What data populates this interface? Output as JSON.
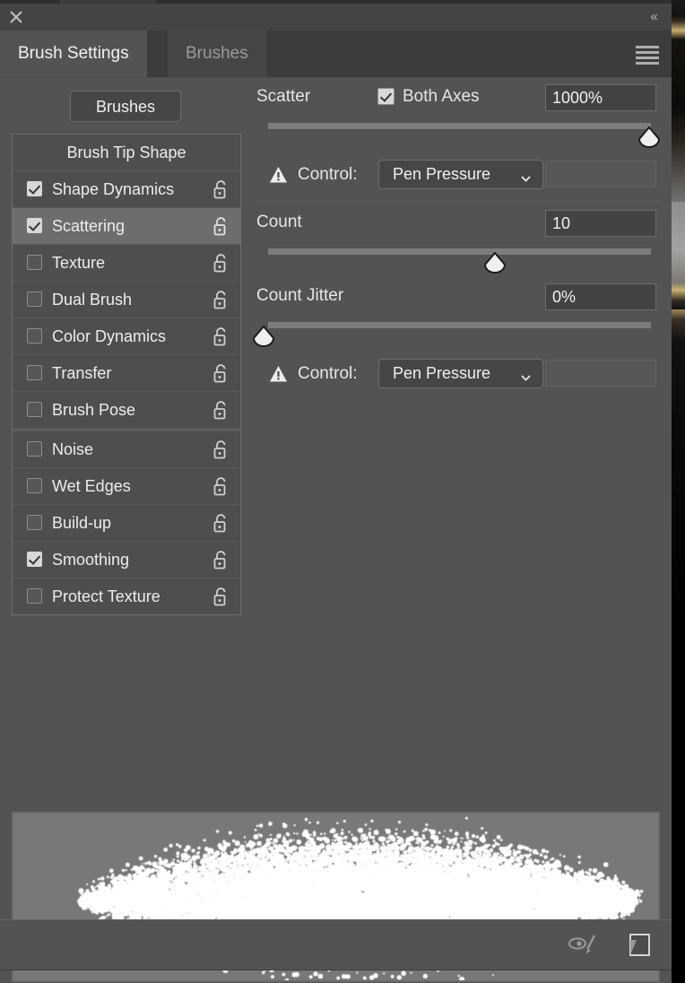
{
  "window": {
    "close_icon": "close-icon",
    "collapse_icon": "collapse-double-chevron-left",
    "collapse_glyph": "«"
  },
  "tabs": [
    {
      "label": "Brush Settings",
      "active": true
    },
    {
      "label": "Brushes",
      "active": false
    }
  ],
  "panel_menu": {
    "icon": "hamburger-menu-icon"
  },
  "toolbar": {
    "brushes_button": "Brushes"
  },
  "option_list": {
    "header": "Brush Tip Shape",
    "items": [
      {
        "label": "Shape Dynamics",
        "checked": true,
        "selected": false,
        "lock": "unlocked-padlock-icon",
        "gap": false
      },
      {
        "label": "Scattering",
        "checked": true,
        "selected": true,
        "lock": "unlocked-padlock-icon",
        "gap": false
      },
      {
        "label": "Texture",
        "checked": false,
        "selected": false,
        "lock": "unlocked-padlock-icon",
        "gap": false
      },
      {
        "label": "Dual Brush",
        "checked": false,
        "selected": false,
        "lock": "unlocked-padlock-icon",
        "gap": false
      },
      {
        "label": "Color Dynamics",
        "checked": false,
        "selected": false,
        "lock": "unlocked-padlock-icon",
        "gap": false
      },
      {
        "label": "Transfer",
        "checked": false,
        "selected": false,
        "lock": "unlocked-padlock-icon",
        "gap": false
      },
      {
        "label": "Brush Pose",
        "checked": false,
        "selected": false,
        "lock": "unlocked-padlock-icon",
        "gap": false
      },
      {
        "label": "Noise",
        "checked": false,
        "selected": false,
        "lock": "unlocked-padlock-icon",
        "gap": true
      },
      {
        "label": "Wet Edges",
        "checked": false,
        "selected": false,
        "lock": "unlocked-padlock-icon",
        "gap": false
      },
      {
        "label": "Build-up",
        "checked": false,
        "selected": false,
        "lock": "unlocked-padlock-icon",
        "gap": false
      },
      {
        "label": "Smoothing",
        "checked": true,
        "selected": false,
        "lock": "unlocked-padlock-icon",
        "gap": false
      },
      {
        "label": "Protect Texture",
        "checked": false,
        "selected": false,
        "lock": "unlocked-padlock-icon",
        "gap": false
      }
    ]
  },
  "settings": {
    "scatter": {
      "label": "Scatter",
      "both_axes_label": "Both Axes",
      "both_axes_checked": true,
      "value": "1000%",
      "slider_percent": 100,
      "control_label": "Control:",
      "control_value": "Pen Pressure",
      "control_extra_value": "",
      "warning_icon": "warning-triangle-icon",
      "caret_icon": "chevron-down-icon"
    },
    "count": {
      "label": "Count",
      "value": "10",
      "slider_percent": 58
    },
    "count_jitter": {
      "label": "Count Jitter",
      "value": "0%",
      "slider_percent": 0,
      "control_label": "Control:",
      "control_value": "Pen Pressure",
      "control_extra_value": "",
      "warning_icon": "warning-triangle-icon",
      "caret_icon": "chevron-down-icon"
    }
  },
  "preview": {
    "name": "brush-stroke-preview"
  },
  "footer": {
    "live_tip_icon": "eye-brush-live-tip-icon",
    "new_brush_icon": "new-brush-preset-icon"
  },
  "colors": {
    "panel_bg": "#535353",
    "titlebar_bg": "#444444",
    "tabstrip_bg": "#3c3c3c",
    "active_tab_bg": "#535353",
    "list_bg": "#4e4e4e",
    "list_selected_bg": "#6d6d6d",
    "field_bg": "#434343",
    "slider_track": "#7d7d7d",
    "text": "#ededed",
    "preview_bg": "#787878"
  }
}
